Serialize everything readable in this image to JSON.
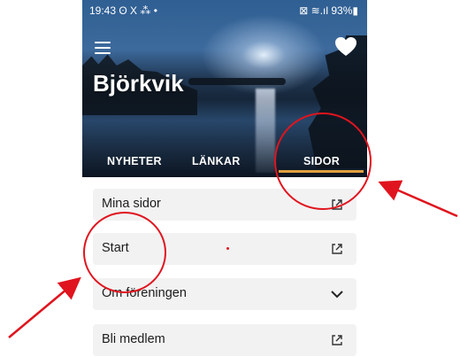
{
  "statusbar": {
    "time": "19:43",
    "indicators": "ʘ X ⁂ •",
    "battery": "⊠ ≋.ıl 93%▮"
  },
  "header": {
    "title": "Björkvik",
    "menu_icon": "menu-icon",
    "favorite_icon": "heart-icon"
  },
  "tabs": [
    {
      "label": "NYHETER",
      "active": false
    },
    {
      "label": "LÄNKAR",
      "active": false
    },
    {
      "label": "SIDOR",
      "active": true
    }
  ],
  "list": [
    {
      "label": "Mina sidor",
      "icon": "external-link-icon"
    },
    {
      "label": "Start",
      "icon": "external-link-icon"
    },
    {
      "label": "Om föreningen",
      "icon": "chevron-down-icon"
    },
    {
      "label": "Bli medlem",
      "icon": "external-link-icon"
    }
  ],
  "colors": {
    "accent": "#e0a040",
    "annotation": "#e0141e",
    "row_bg": "#f2f2f2"
  }
}
